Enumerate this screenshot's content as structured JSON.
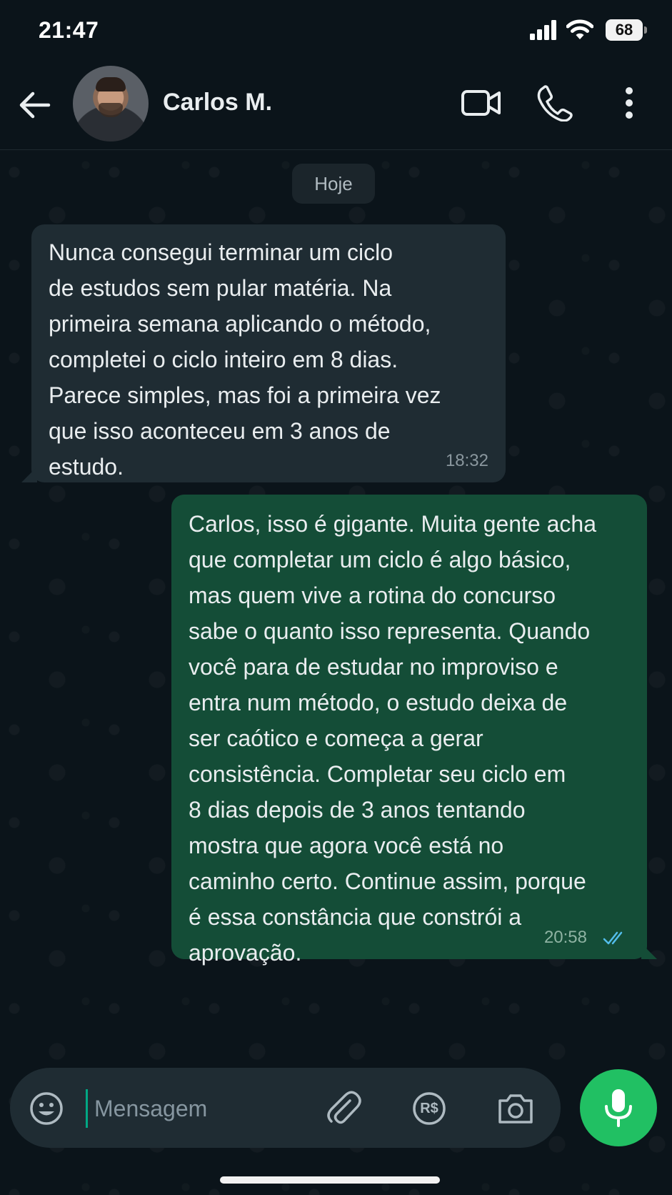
{
  "status_bar": {
    "time": "21:47",
    "battery": "68"
  },
  "header": {
    "contact_name": "Carlos M.",
    "icons": [
      "back-arrow-icon",
      "video-call-icon",
      "phone-icon",
      "more-options-icon"
    ]
  },
  "chat": {
    "date_label": "Hoje",
    "messages": [
      {
        "direction": "incoming",
        "text": "Nunca consegui terminar um ciclo\nde estudos sem pular matéria. Na\nprimeira semana aplicando o método,\ncompletei o ciclo inteiro em 8 dias.\nParece simples, mas foi a primeira vez\nque isso aconteceu em 3 anos de\nestudo.",
        "time": "18:32"
      },
      {
        "direction": "outgoing",
        "text": "Carlos, isso é gigante. Muita gente acha\nque completar um ciclo é algo básico,\nmas quem vive a rotina do concurso\nsabe o quanto isso representa. Quando\nvocê para de estudar no improviso e\nentra num método, o estudo deixa de\nser caótico e começa a gerar\nconsistência. Completar seu ciclo em\n8 dias depois de 3 anos tentando\nmostra que agora você está no\ncaminho certo. Continue assim, porque\né essa constância que constrói a\naprovação.",
        "time": "20:58",
        "status": "read"
      }
    ]
  },
  "composer": {
    "placeholder": "Mensagem",
    "value": "",
    "pix_label": "R$",
    "icons": [
      "emoji-icon",
      "attach-icon",
      "pix-payment-icon",
      "camera-icon",
      "microphone-icon"
    ]
  },
  "colors": {
    "background": "#0b141a",
    "incoming_bubble": "#1f2c33",
    "outgoing_bubble": "#144d37",
    "accent_green": "#21c063",
    "read_ticks": "#53bdeb"
  }
}
